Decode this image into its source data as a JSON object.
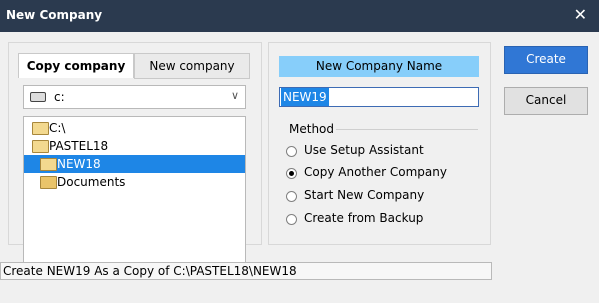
{
  "window": {
    "title": "New Company",
    "close_glyph": "✕"
  },
  "left_panel": {
    "tabs": [
      {
        "label": "Copy company"
      },
      {
        "label": "New company"
      }
    ],
    "drive_select": {
      "icon": "drive-icon",
      "value": "c:",
      "chevron": "∨"
    },
    "tree": [
      {
        "label": "C:\\"
      },
      {
        "label": "PASTEL18"
      },
      {
        "label": "NEW18"
      },
      {
        "label": "Documents"
      }
    ]
  },
  "right_panel": {
    "header_label": "New Company Name",
    "name_value": "NEW19",
    "method_label": "Method",
    "options": [
      {
        "label": "Use Setup Assistant"
      },
      {
        "label": "Copy Another Company"
      },
      {
        "label": "Start New Company"
      },
      {
        "label": "Create from Backup"
      }
    ]
  },
  "buttons": {
    "create": "Create",
    "cancel": "Cancel"
  },
  "status_text": "Create NEW19 As a Copy of C:\\PASTEL18\\NEW18"
}
